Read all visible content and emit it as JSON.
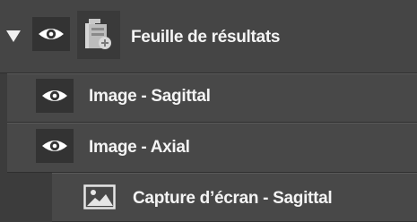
{
  "tree": {
    "root": {
      "label": "Feuille de résultats",
      "expand_icon": "triangle-down-icon",
      "visibility_icon": "eye-icon",
      "type_icon": "results-sheet-icon"
    },
    "children": [
      {
        "label": "Image - Sagittal",
        "visibility_icon": "eye-icon"
      },
      {
        "label": "Image - Axial",
        "visibility_icon": "eye-icon"
      },
      {
        "label": "Capture d’écran - Sagittal",
        "type_icon": "image-icon"
      }
    ]
  },
  "colors": {
    "background": "#3c3c3c",
    "row": "#484848",
    "text": "#f4f4f4",
    "icon_box": "#333333"
  }
}
